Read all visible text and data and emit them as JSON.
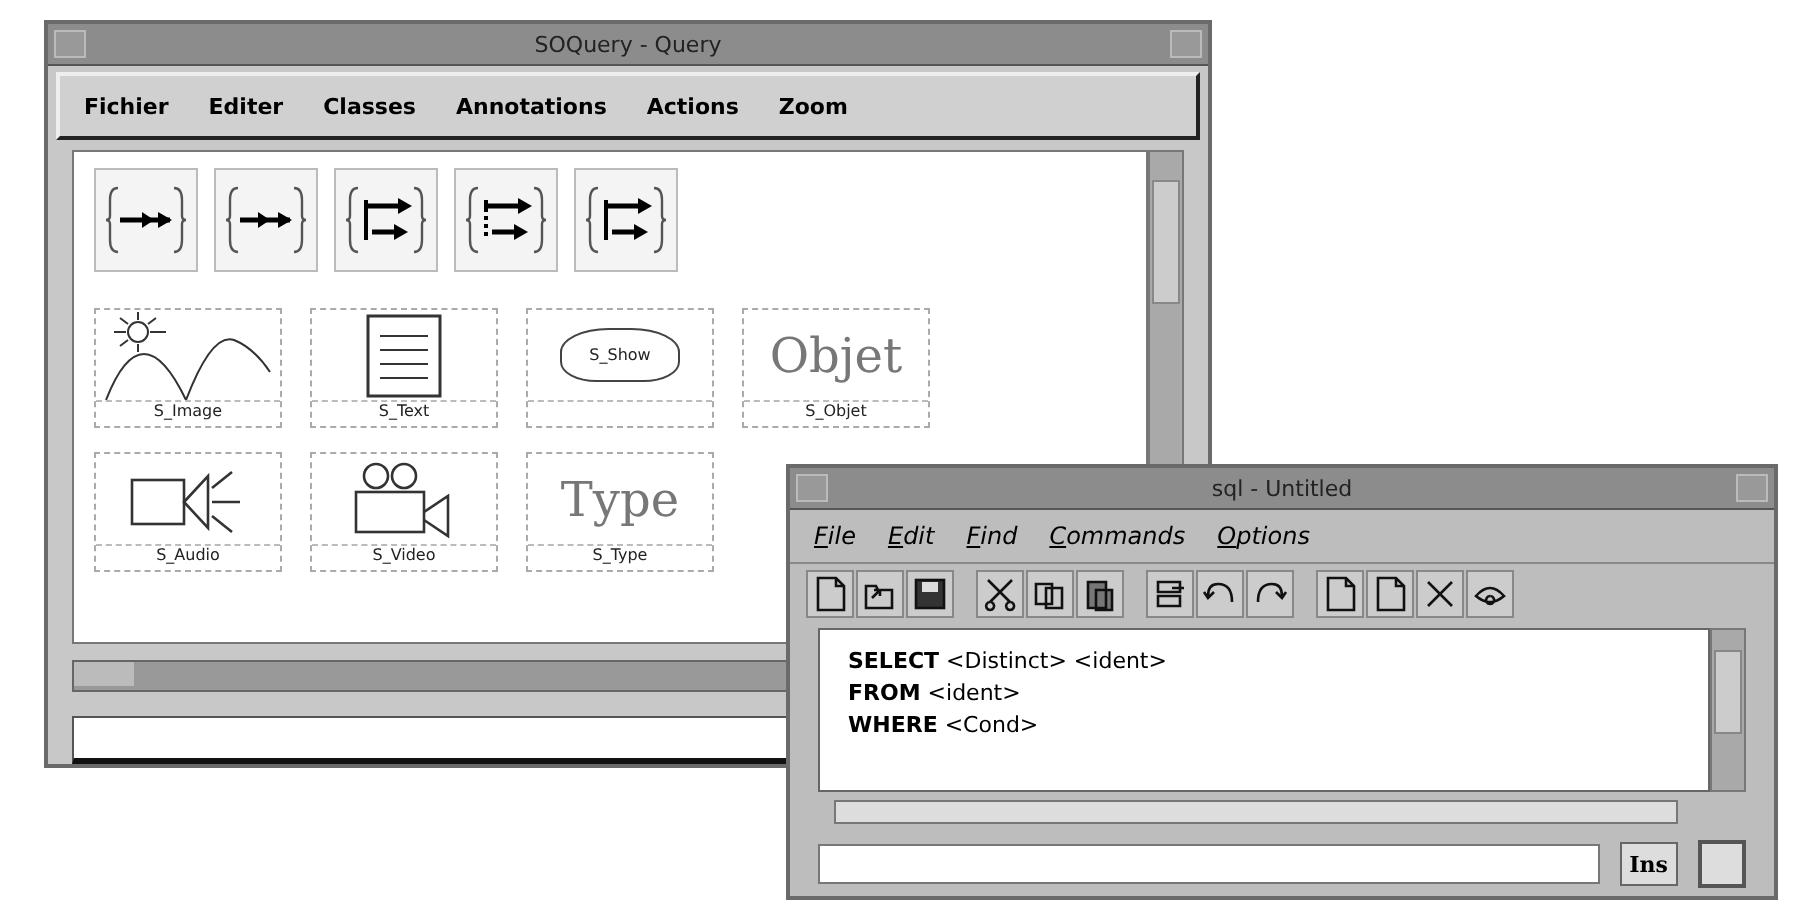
{
  "query_window": {
    "title": "SOQuery - Query",
    "menu": [
      "Fichier",
      "Editer",
      "Classes",
      "Annotations",
      "Actions",
      "Zoom"
    ],
    "components": [
      {
        "kind": "image",
        "label": "S_Image"
      },
      {
        "kind": "text",
        "label": "S_Text"
      },
      {
        "kind": "show",
        "label": "S_Show"
      },
      {
        "kind": "word",
        "word": "Objet",
        "label": "S_Objet"
      },
      {
        "kind": "audio",
        "label": "S_Audio"
      },
      {
        "kind": "video",
        "label": "S_Video"
      },
      {
        "kind": "word",
        "word": "Type",
        "label": "S_Type"
      }
    ]
  },
  "sql_window": {
    "title": "sql - Untitled",
    "menu": [
      "File",
      "Edit",
      "Find",
      "Commands",
      "Options"
    ],
    "query_lines": [
      "**SELECT** <Distinct> <ident>",
      "**FROM** <ident>",
      "**WHERE** <Cond>"
    ],
    "insert_button": "Ins"
  }
}
